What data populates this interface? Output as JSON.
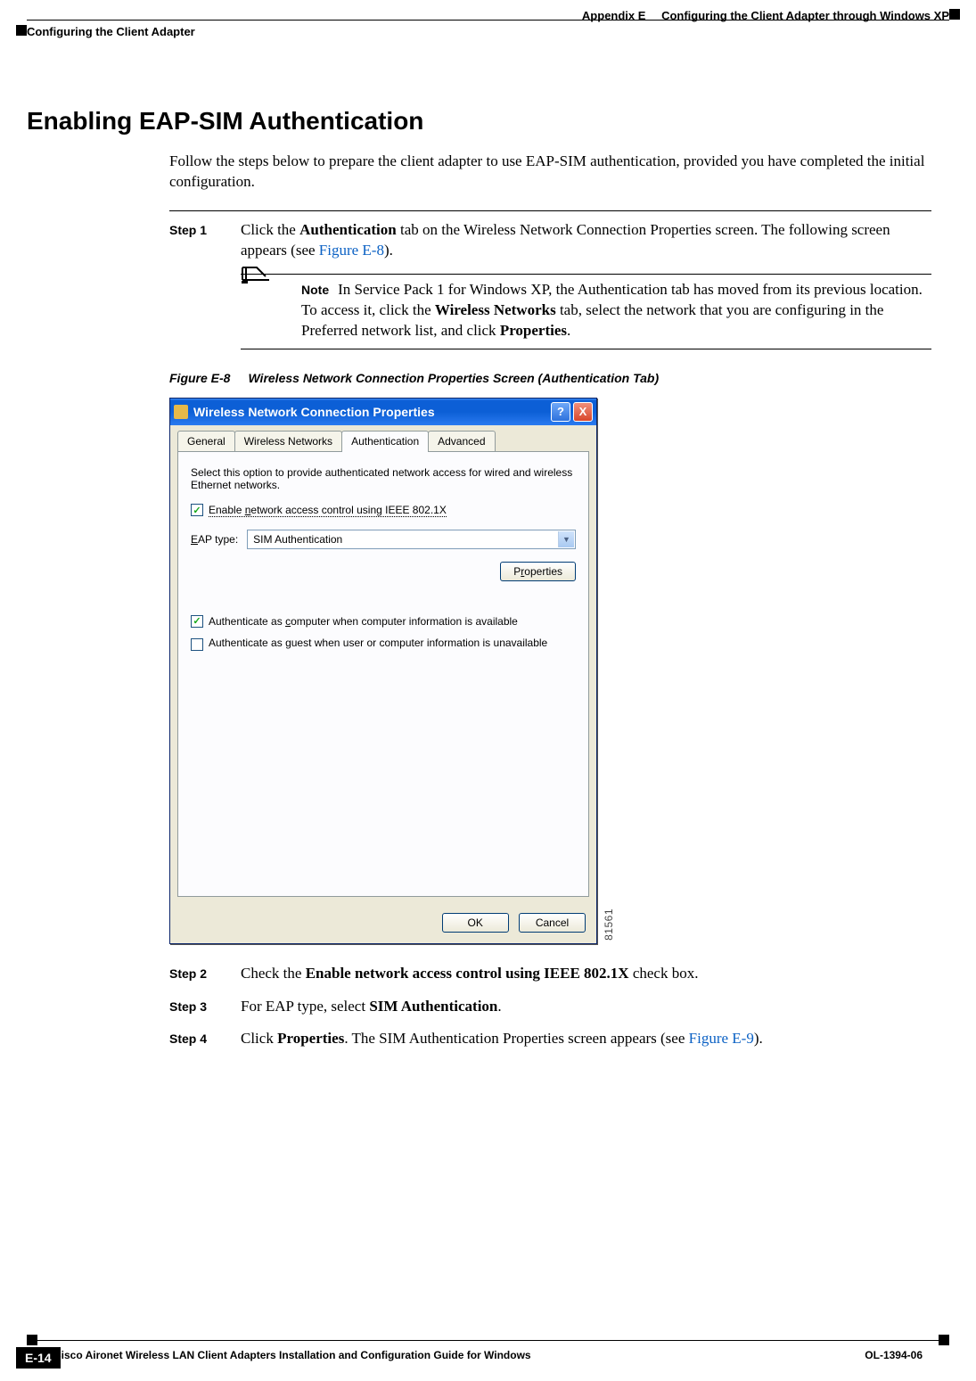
{
  "header": {
    "appendix_label": "Appendix E",
    "appendix_title": "Configuring the Client Adapter through Windows XP",
    "section_path": "Configuring the Client Adapter"
  },
  "section": {
    "title": "Enabling EAP-SIM Authentication",
    "intro": "Follow the steps below to prepare the client adapter to use EAP-SIM authentication, provided you have completed the initial configuration."
  },
  "steps": [
    {
      "label": "Step 1",
      "pre": "Click the ",
      "bold1": "Authentication",
      "mid": " tab on the Wireless Network Connection Properties screen. The following screen appears (see ",
      "link": "Figure E-8",
      "post": ")."
    },
    {
      "label": "Step 2",
      "pre": "Check the ",
      "bold1": "Enable network access control using IEEE 802.1X",
      "post": " check box."
    },
    {
      "label": "Step 3",
      "pre": "For EAP type, select ",
      "bold1": "SIM Authentication",
      "post": "."
    },
    {
      "label": "Step 4",
      "pre": "Click ",
      "bold1": "Properties",
      "mid": ". The SIM Authentication Properties screen appears (see ",
      "link": "Figure E-9",
      "post": ")."
    }
  ],
  "note": {
    "label": "Note",
    "body_pre": "In Service Pack 1 for Windows XP, the Authentication tab has moved from its previous location. To access it, click the ",
    "body_b1": "Wireless Networks",
    "body_mid": " tab, select the network that you are configuring in the Preferred network list, and click ",
    "body_b2": "Properties",
    "body_post": "."
  },
  "figure": {
    "num": "Figure E-8",
    "title": "Wireless Network Connection Properties Screen (Authentication Tab)",
    "side_code": "81561"
  },
  "dialog": {
    "title": "Wireless Network Connection Properties",
    "tabs": [
      "General",
      "Wireless Networks",
      "Authentication",
      "Advanced"
    ],
    "active_tab": 2,
    "desc": "Select this option to provide authenticated network access for wired and wireless Ethernet networks.",
    "chk1_pre": "Enable ",
    "chk1_u": "n",
    "chk1_post": "etwork access control using IEEE 802.1X",
    "eap_label_pre": "",
    "eap_label_u": "E",
    "eap_label_post": "AP type:",
    "eap_value": "SIM Authentication",
    "properties_btn_pre": "P",
    "properties_btn_u": "r",
    "properties_btn_post": "operties",
    "chk2_pre": "Authenticate as ",
    "chk2_u": "c",
    "chk2_post": "omputer when computer information is available",
    "chk3_pre": "Authenticate as ",
    "chk3_u": "g",
    "chk3_post": "uest when user or computer information is unavailable",
    "ok": "OK",
    "cancel": "Cancel",
    "help": "?",
    "close": "X"
  },
  "footer": {
    "book_title": "Cisco Aironet Wireless LAN Client Adapters Installation and Configuration Guide for Windows",
    "doc_num": "OL-1394-06",
    "page": "E-14"
  }
}
